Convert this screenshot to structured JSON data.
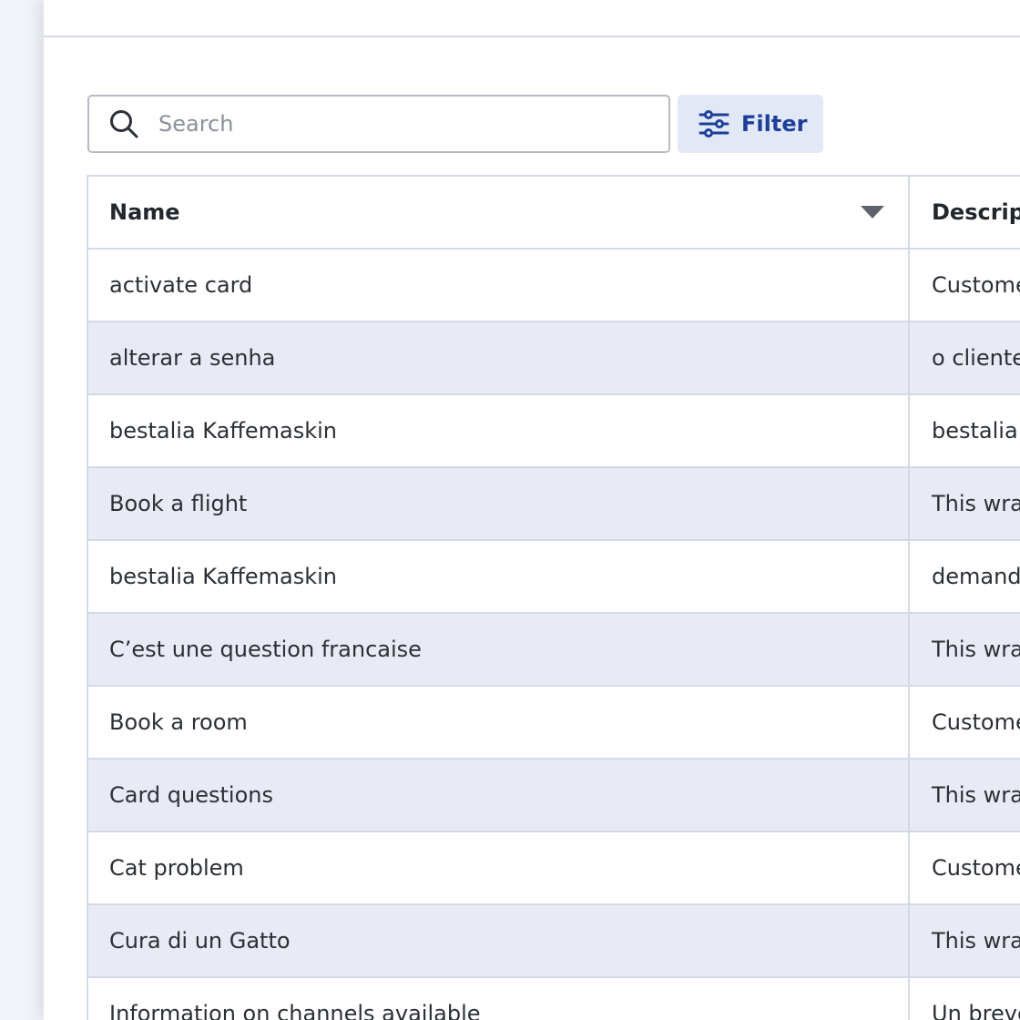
{
  "search": {
    "placeholder": "Search",
    "value": ""
  },
  "filter": {
    "label": "Filter"
  },
  "icons": {
    "search": "search-icon",
    "filter": "sliders-icon",
    "sort": "caret-down-icon"
  },
  "colors": {
    "accent": "#1d3f9a",
    "filter_bg": "#e3e8f7",
    "row_alt": "#e8ebf3",
    "border": "#d3d9e6"
  },
  "table": {
    "columns": [
      "Name",
      "Descript"
    ],
    "rows": [
      {
        "name": "activate card",
        "description": "Customer"
      },
      {
        "name": "alterar a senha",
        "description": "o cliente p"
      },
      {
        "name": "bestalia Kaffemaskin",
        "description": "bestalia K"
      },
      {
        "name": "Book a flight",
        "description": "This wrap"
      },
      {
        "name": "bestalia Kaffemaskin",
        "description": "demanda"
      },
      {
        "name": "C’est une question francaise",
        "description": "This wrap"
      },
      {
        "name": "Book a room",
        "description": "Customer"
      },
      {
        "name": "Card questions",
        "description": "This wrap"
      },
      {
        "name": "Cat problem",
        "description": "Customer"
      },
      {
        "name": "Cura di un Gatto",
        "description": "This wrap"
      },
      {
        "name": "Information on channels available",
        "description": "Un breve"
      }
    ]
  }
}
